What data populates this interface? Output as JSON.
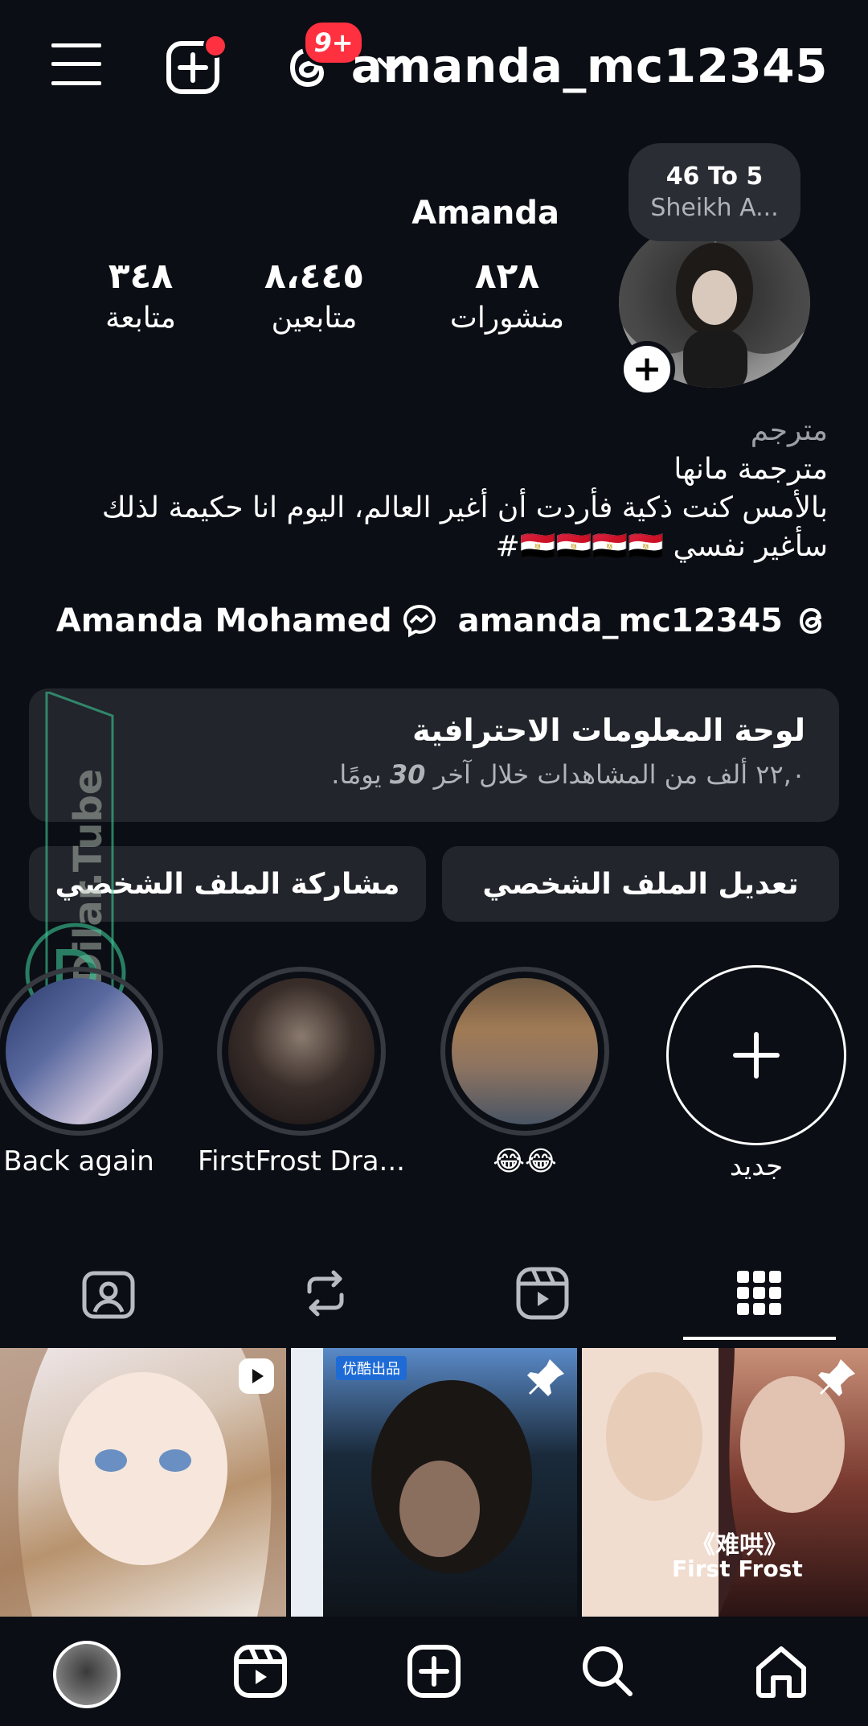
{
  "header": {
    "username": "amanda_mc12345",
    "threads_badge": "9+"
  },
  "note": {
    "line1": "46 To 5",
    "line2": "Sheikh A..."
  },
  "profile": {
    "display_name": "Amanda",
    "stats": [
      {
        "value": "٨٢٨",
        "label": "منشورات"
      },
      {
        "value": "٨،٤٤٥",
        "label": "متابعين"
      },
      {
        "value": "٣٤٨",
        "label": "متابعة"
      }
    ],
    "bio": {
      "category": "مترجم",
      "lines": [
        "مترجمة مانها",
        "بالأمس كنت ذكية فأردت أن أغير العالم، اليوم انا حكيمة لذلك",
        "سأغير نفسي 🇪🇬🇪🇬🇪🇬🇪🇬#"
      ]
    },
    "threads_handle": "amanda_mc12345",
    "facebook_name": "Amanda Mohamed"
  },
  "dashboard": {
    "title": "لوحة المعلومات الاحترافية",
    "subtitle_prefix": "٢٢,٠ ألف من المشاهدات خلال آخر",
    "days": "30",
    "subtitle_suffix": "يومًا."
  },
  "buttons": {
    "edit": "تعديل الملف الشخصي",
    "share": "مشاركة الملف الشخصي"
  },
  "highlights": [
    {
      "label": "جديد"
    },
    {
      "label": "😂😂"
    },
    {
      "label": "FirstFrost Dra..."
    },
    {
      "label": "Back again"
    }
  ],
  "watermark": "Dilar.Tube",
  "posts": [
    {
      "caption": "《难哄》",
      "caption2": "First Frost"
    },
    {
      "caption": "优酷出品"
    },
    {
      "caption": ""
    }
  ],
  "colors": {
    "background": "#0b0e14",
    "surface": "#22252b",
    "badge": "#ff3040"
  }
}
